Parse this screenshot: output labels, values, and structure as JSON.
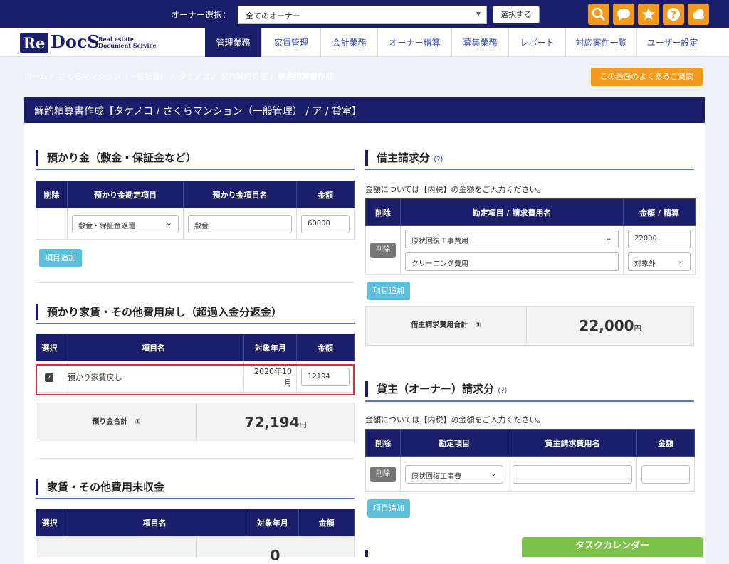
{
  "topbar": {
    "owner_label": "オーナー選択：",
    "owner_value": "全てのオーナー",
    "select_button": "選択する",
    "icons": [
      "search-icon",
      "chat-icon",
      "star-icon",
      "help-icon",
      "cloud-icon"
    ]
  },
  "logo": {
    "re": "Re",
    "docs": "DocS",
    "sub1": "Real estate",
    "sub2": "Document Service"
  },
  "nav": {
    "tabs": [
      "管理業務",
      "家賃管理",
      "会計業務",
      "オーナー精算",
      "募集業務",
      "レポート",
      "対応案件一覧",
      "ユーザー設定"
    ],
    "active": "管理業務"
  },
  "breadcrumb": {
    "items": [
      "ホーム",
      "さくらマンション（一般管理）",
      "タケノコ",
      "契約解約処理"
    ],
    "current": "解約精算書作成",
    "sep": "/"
  },
  "faq_button": "この画面のよくあるご質問",
  "page_title": "解約精算書作成【タケノコ / さくらマンション（一般管理） / ア / 貸室】",
  "deposit": {
    "title": "預かり金（敷金・保証金など）",
    "headers": [
      "削除",
      "預かり金勘定項目",
      "預かり金項目名",
      "金額"
    ],
    "row": {
      "item": "敷金・保証金返還",
      "name": "敷金",
      "amount": "60000"
    },
    "add_button": "項目追加"
  },
  "rent_return": {
    "title": "預かり家賃・その他費用戻し（超過入金分返金）",
    "headers": [
      "選択",
      "項目名",
      "対象年月",
      "金額"
    ],
    "row": {
      "checked": true,
      "check_mark": "✓",
      "name": "預かり家賃戻し",
      "month": "2020年10月",
      "amount": "12194"
    },
    "total_label": "預り金合計　①",
    "total_value": "72,194",
    "total_unit": "円"
  },
  "unpaid": {
    "title": "家賃・その他費用未収金",
    "headers": [
      "選択",
      "項目名",
      "対象年月",
      "金額"
    ],
    "partial_value": "0"
  },
  "tenant_claim": {
    "title": "借主請求分",
    "help": "(?)",
    "note": "金額については【内税】の金額をご入力ください。",
    "headers": [
      "削除",
      "勘定項目 / 請求費用名",
      "金額 / 精算"
    ],
    "row": {
      "delete": "削除",
      "item": "原状回復工事費用",
      "amount": "22000",
      "name": "クリーニング費用",
      "settle": "対象外"
    },
    "add_button": "項目追加",
    "total_label": "借主請求費用合計　③",
    "total_value": "22,000",
    "total_unit": "円"
  },
  "owner_claim": {
    "title": "貸主（オーナー）請求分",
    "help": "(?)",
    "note": "金額については【内税】の金額をご入力ください。",
    "headers": [
      "削除",
      "勘定項目",
      "貸主請求費用名",
      "金額"
    ],
    "row": {
      "delete": "削除",
      "item": "原状回復工事費",
      "name": "",
      "amount": ""
    },
    "add_button": "項目追加"
  },
  "task_calendar": "タスクカレンダー",
  "colors": {
    "navy": "#1b1e6a",
    "orange": "#f29a1c",
    "cyan": "#5bc0de",
    "green": "#7cc24a",
    "highlight_red": "#e22b3a"
  }
}
